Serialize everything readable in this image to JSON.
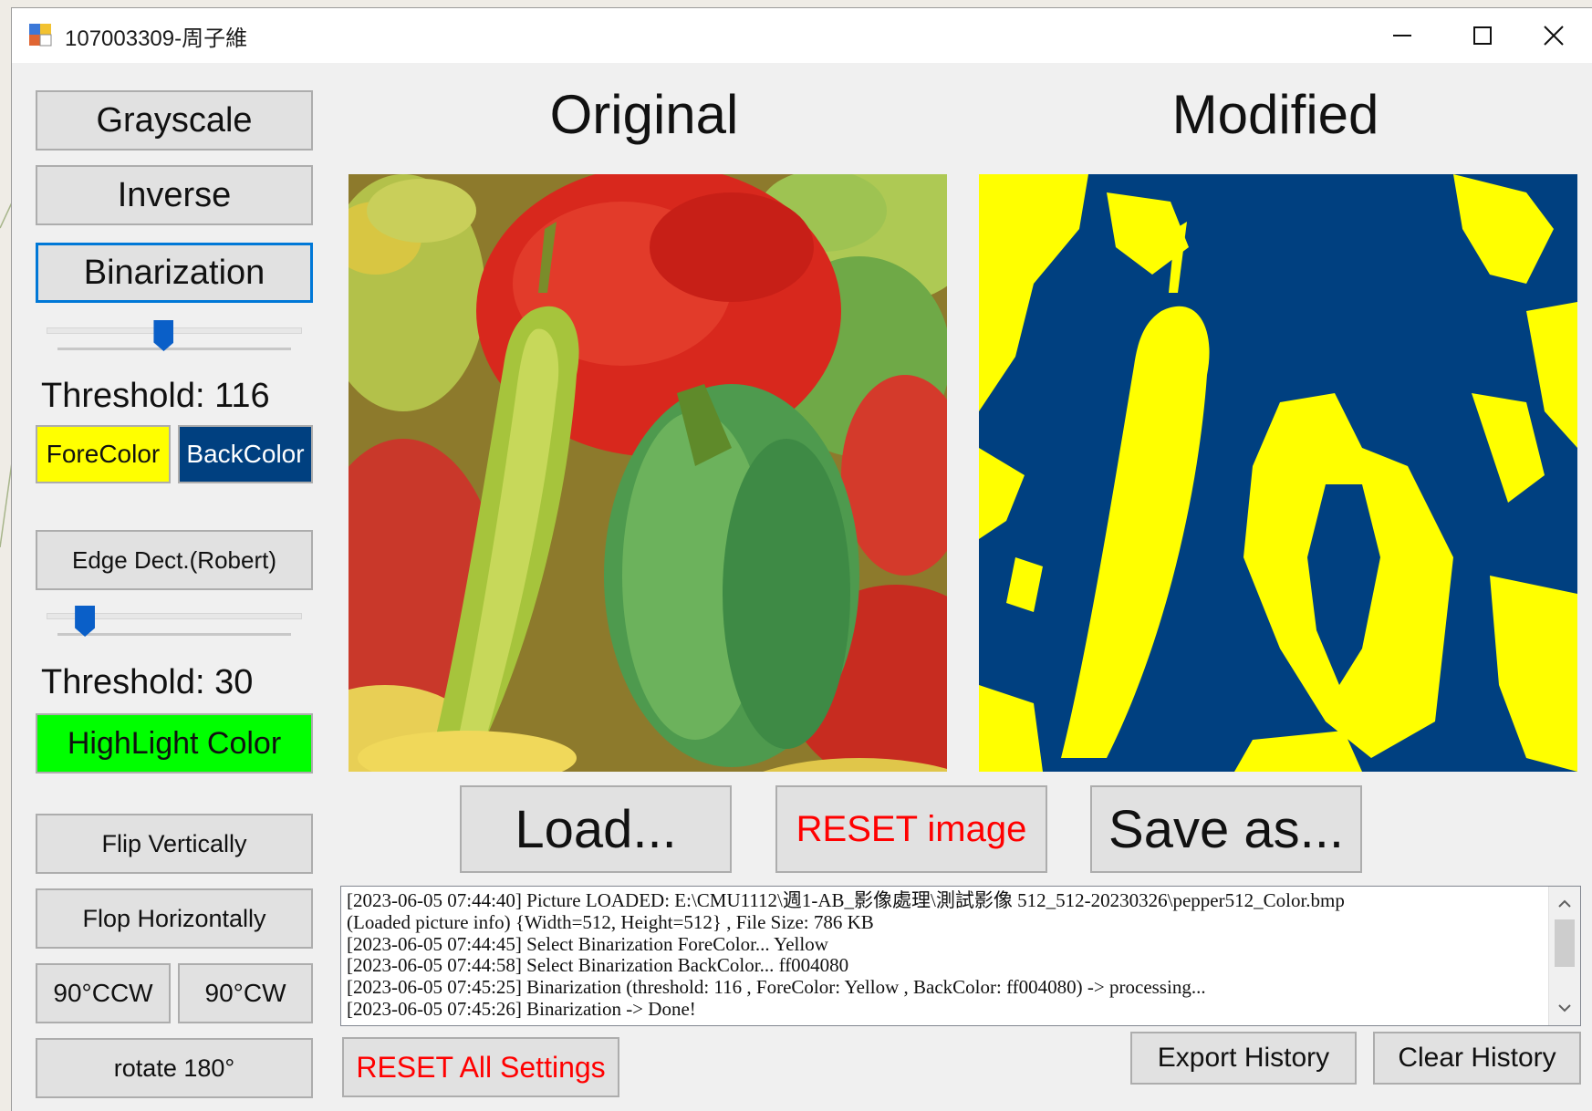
{
  "window": {
    "title": "107003309-周子維",
    "minimize_glyph": "—",
    "maximize_glyph": "☐",
    "close_glyph": "✕"
  },
  "sidebar": {
    "grayscale": "Grayscale",
    "inverse": "Inverse",
    "binarization": "Binarization",
    "binarization_threshold_label": "Threshold: 116",
    "binarization_threshold_value": 116,
    "binarization_threshold_max": 255,
    "forecolor": "ForeColor",
    "backcolor": "BackColor",
    "edge_detect": "Edge Dect.(Robert)",
    "edge_threshold_label": "Threshold: 30",
    "edge_threshold_value": 30,
    "edge_threshold_max": 255,
    "highlight_color": "HighLight Color",
    "flip_vertically": "Flip Vertically",
    "flop_horizontally": "Flop Horizontally",
    "rotate_ccw": "90°CCW",
    "rotate_cw": "90°CW",
    "rotate_180": "rotate 180°"
  },
  "panels": {
    "original_title": "Original",
    "modified_title": "Modified"
  },
  "actions": {
    "load": "Load...",
    "reset_image": "RESET image",
    "save_as": "Save as..."
  },
  "log": {
    "lines": [
      "[2023-06-05 07:44:40] Picture LOADED: E:\\CMU1112\\週1-AB_影像處理\\測試影像 512_512-20230326\\pepper512_Color.bmp",
      "(Loaded picture info) {Width=512, Height=512} , File Size: 786 KB",
      "[2023-06-05 07:44:45] Select Binarization ForeColor... Yellow",
      "[2023-06-05 07:44:58] Select Binarization BackColor... ff004080",
      "[2023-06-05 07:45:25] Binarization (threshold: 116 , ForeColor: Yellow , BackColor: ff004080) -> processing...",
      "[2023-06-05 07:45:26] Binarization -> Done!"
    ]
  },
  "bottom": {
    "reset_all": "RESET All Settings",
    "export_history": "Export History",
    "clear_history": "Clear History"
  },
  "colors": {
    "fore": "#ffff00",
    "back": "#004080",
    "highlight": "#00ff00",
    "accent_red": "#ff0000",
    "focus_blue": "#0078d7"
  },
  "icons": {
    "app": "app-window-icon",
    "minimize": "minimize-icon",
    "maximize": "maximize-icon",
    "close": "close-icon",
    "scroll_up": "chevron-up-icon",
    "scroll_down": "chevron-down-icon"
  }
}
